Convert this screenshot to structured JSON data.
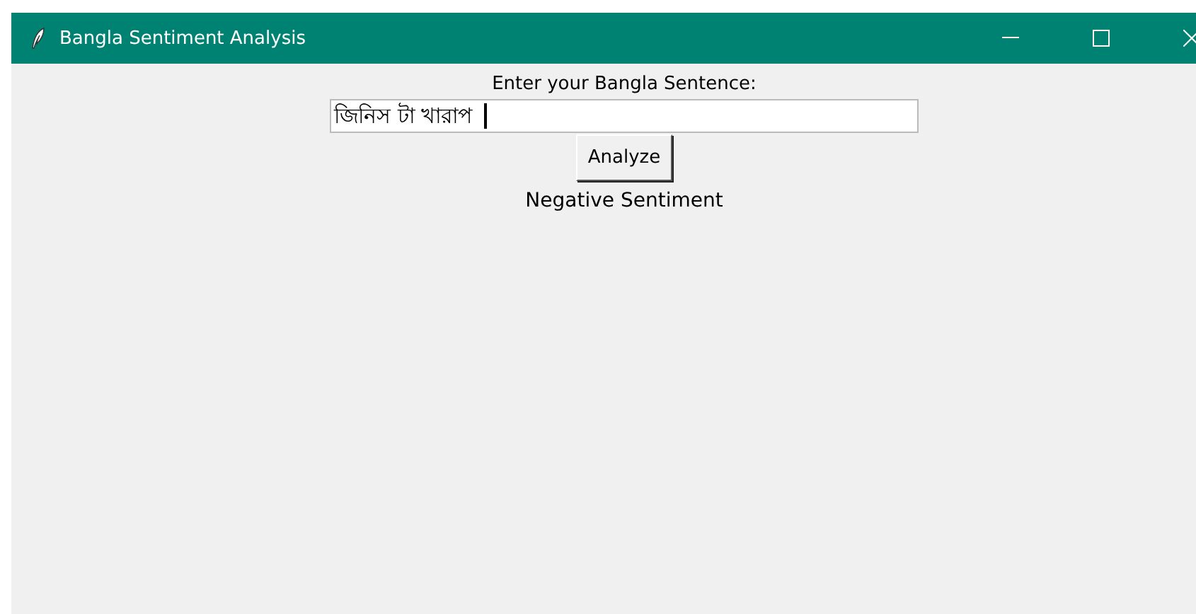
{
  "window": {
    "title": "Bangla Sentiment Analysis"
  },
  "prompt": "Enter your Bangla Sentence:",
  "input": {
    "value": "জিনিস টা খারাপ "
  },
  "button": "Analyze",
  "result": "Negative Sentiment"
}
